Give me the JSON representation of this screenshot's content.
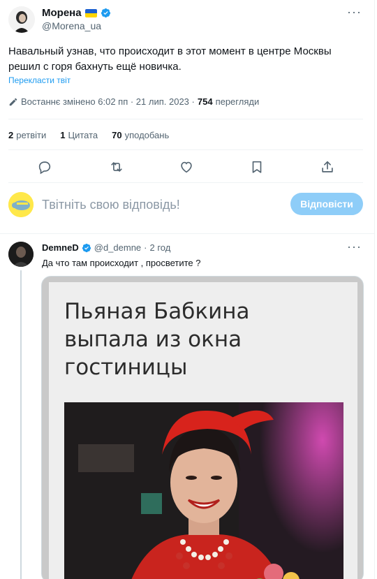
{
  "tweet": {
    "author_name": "Морена",
    "author_handle": "@Morena_ua",
    "text": "Навальный узнав, что происходит в этот момент в центре Москвы\nрешил с горя бахнуть ещё новичка.",
    "translate_label": "Перекласти твіт",
    "edited_label": "Востаннє змінено 6:02 пп · 21 лип. 2023 ·",
    "views_count": "754",
    "views_label": "перегляди",
    "stats": {
      "retweets_count": "2",
      "retweets_label": "ретвіти",
      "quotes_count": "1",
      "quotes_label": "Цитата",
      "likes_count": "70",
      "likes_label": "уподобань"
    },
    "actions": [
      "reply-icon",
      "retweet-icon",
      "like-icon",
      "bookmark-icon",
      "share-icon"
    ],
    "flag_colors": [
      "#1a5fd0",
      "#ffd500"
    ]
  },
  "composer": {
    "placeholder": "Твітніть свою відповідь!",
    "reply_button": "Відповісти"
  },
  "reply": {
    "author_name": "DemneD",
    "author_handle": "@d_demne",
    "separator": "·",
    "time": "2 год",
    "text": "Да что там происходит , просветите ?",
    "media_headline": "Пьяная Бабкина\nвыпала из окна\nгостиницы"
  },
  "colors": {
    "accent": "#1d9bf0",
    "reply_button_bg": "#8ecdf8",
    "muted_text": "#536471"
  }
}
